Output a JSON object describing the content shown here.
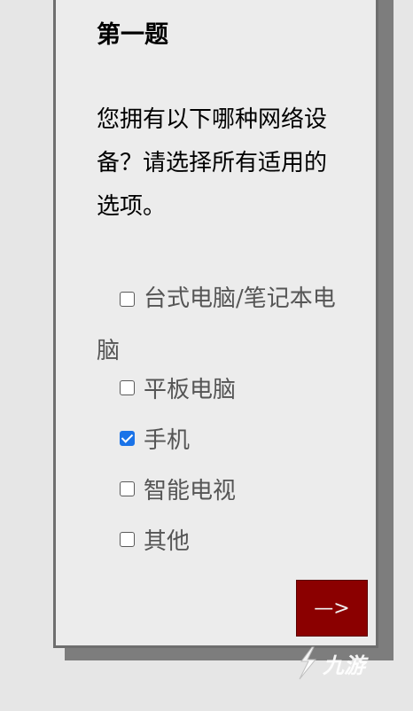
{
  "question": {
    "title": "第一题",
    "text": "您拥有以下哪种网络设备？请选择所有适用的选项。"
  },
  "options": [
    {
      "label": "台式电脑/笔记本电脑",
      "checked": false
    },
    {
      "label": "平板电脑",
      "checked": false
    },
    {
      "label": "手机",
      "checked": true
    },
    {
      "label": "智能电视",
      "checked": false
    },
    {
      "label": "其他",
      "checked": false
    }
  ],
  "next_button": {
    "label": "—>",
    "color": "#8b0000"
  },
  "watermark": {
    "text": "九游"
  },
  "colors": {
    "checkbox_checked": "#1a73e8",
    "card_background": "#ececec"
  }
}
